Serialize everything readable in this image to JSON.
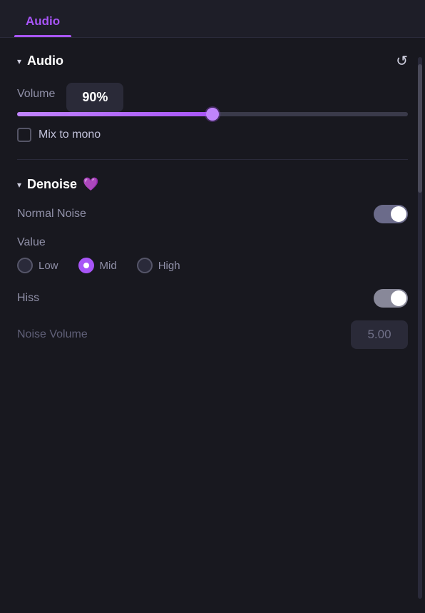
{
  "tabs": [
    {
      "label": "Audio",
      "active": true
    }
  ],
  "audio_section": {
    "title": "Audio",
    "collapsed": false,
    "volume_label": "Volume",
    "volume_value": "90%",
    "volume_percent": 50,
    "mix_to_mono_label": "Mix to mono",
    "mix_to_mono_checked": false
  },
  "denoise_section": {
    "title": "Denoise",
    "has_badge": true,
    "normal_noise_label": "Normal Noise",
    "normal_noise_on": true,
    "value_label": "Value",
    "radio_options": [
      {
        "id": "low",
        "label": "Low",
        "selected": false
      },
      {
        "id": "mid",
        "label": "Mid",
        "selected": true
      },
      {
        "id": "high",
        "label": "High",
        "selected": false
      }
    ],
    "hiss_label": "Hiss",
    "hiss_on": true,
    "noise_volume_label": "Noise Volume",
    "noise_volume_value": "5.00"
  },
  "icons": {
    "chevron": "▾",
    "reset": "↺",
    "diamond": "💜"
  }
}
